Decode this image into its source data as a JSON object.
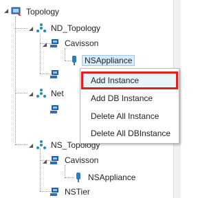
{
  "tree": {
    "root": {
      "label": "Topology",
      "icon": "topology-icon"
    },
    "nodes": [
      {
        "id": "nd-topology",
        "label": "ND_Topology",
        "icon": "topology-network-icon"
      },
      {
        "id": "cavisson-1",
        "label": "Cavisson",
        "icon": "server-icon"
      },
      {
        "id": "nsappliance-1",
        "label": "NSAppliance",
        "icon": "appliance-icon",
        "selected": true
      },
      {
        "id": "server-hidden-1",
        "label": "",
        "icon": "server-icon"
      },
      {
        "id": "network-partial",
        "label": "Net",
        "icon": "topology-network-icon"
      },
      {
        "id": "server-hidden-2",
        "label": "",
        "icon": "server-icon"
      },
      {
        "id": "ns-topology",
        "label": "NS_Topology",
        "icon": "topology-network-icon"
      },
      {
        "id": "cavisson-2",
        "label": "Cavisson",
        "icon": "server-icon"
      },
      {
        "id": "nsappliance-2",
        "label": "NSAppliance",
        "icon": "appliance-icon"
      },
      {
        "id": "nstier",
        "label": "NSTier",
        "icon": "server-icon"
      }
    ]
  },
  "context_menu": {
    "items": [
      {
        "label": "Add Instance",
        "highlighted": true
      },
      {
        "label": "Add DB Instance"
      },
      {
        "label": "Delete All Instance"
      },
      {
        "label": "Delete All DBInstance"
      }
    ],
    "highlight_color": "#e0201e"
  },
  "colors": {
    "selection_bg": "#d6ecfa",
    "network_icon": "#1f8fb3",
    "server_icon": "#1f5ea8",
    "appliance_icon": "#2e7fbf"
  }
}
